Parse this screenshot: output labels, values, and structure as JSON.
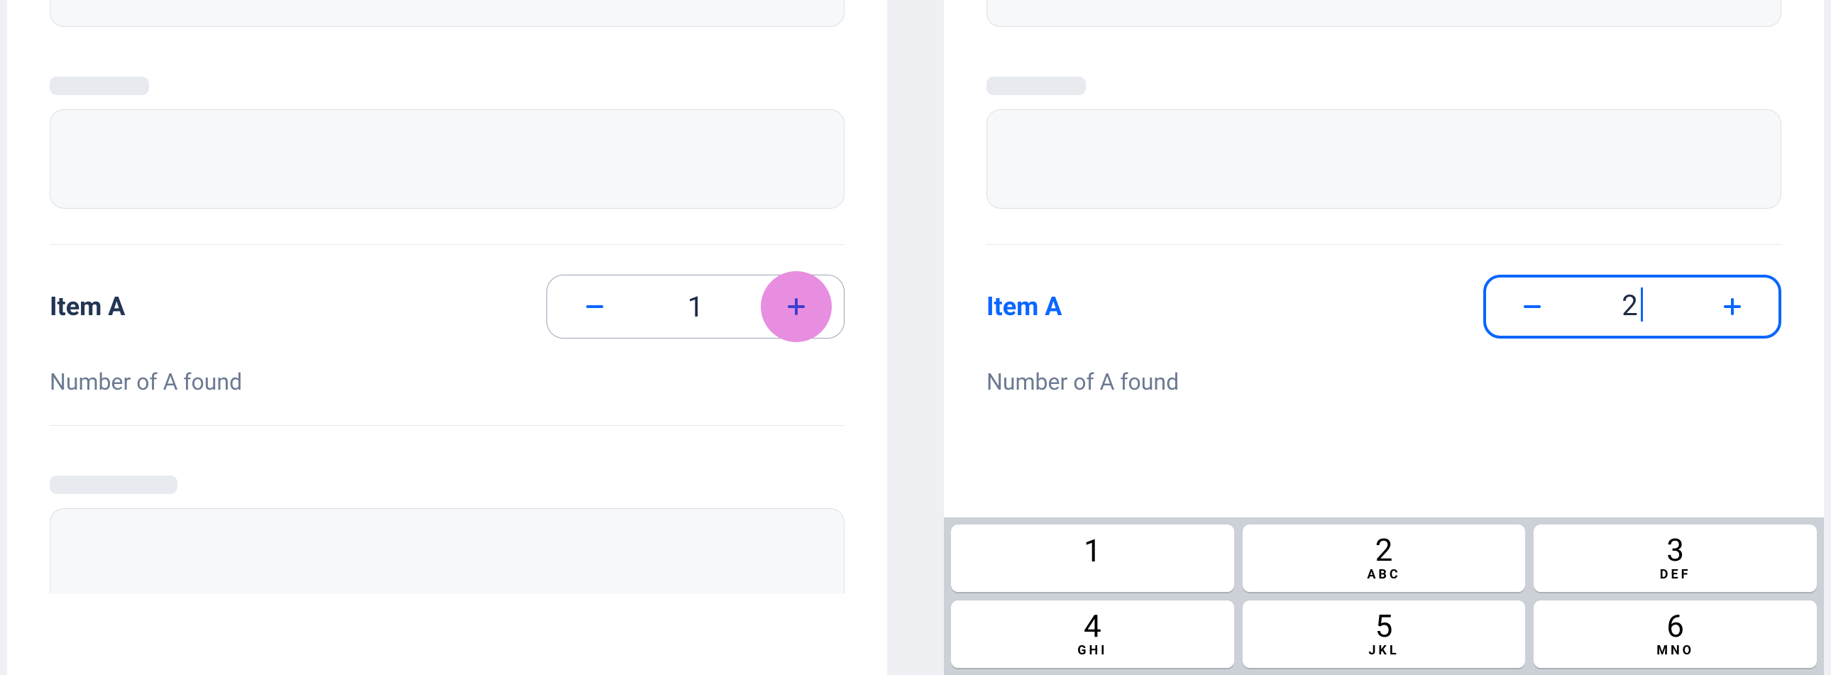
{
  "left": {
    "item_label": "Item A",
    "stepper_value": "1",
    "subtext": "Number of A found",
    "highlighted_button": "plus"
  },
  "right": {
    "item_label": "Item A",
    "stepper_value": "2",
    "subtext": "Number of A found",
    "focused": true
  },
  "keypad": {
    "keys": [
      {
        "digit": "1",
        "letters": ""
      },
      {
        "digit": "2",
        "letters": "ABC"
      },
      {
        "digit": "3",
        "letters": "DEF"
      },
      {
        "digit": "4",
        "letters": "GHI"
      },
      {
        "digit": "5",
        "letters": "JKL"
      },
      {
        "digit": "6",
        "letters": "MNO"
      }
    ]
  },
  "colors": {
    "accent": "#0a66ff",
    "highlight": "#e88ee0",
    "text_dark": "#233554",
    "text_muted": "#6c7a92"
  }
}
